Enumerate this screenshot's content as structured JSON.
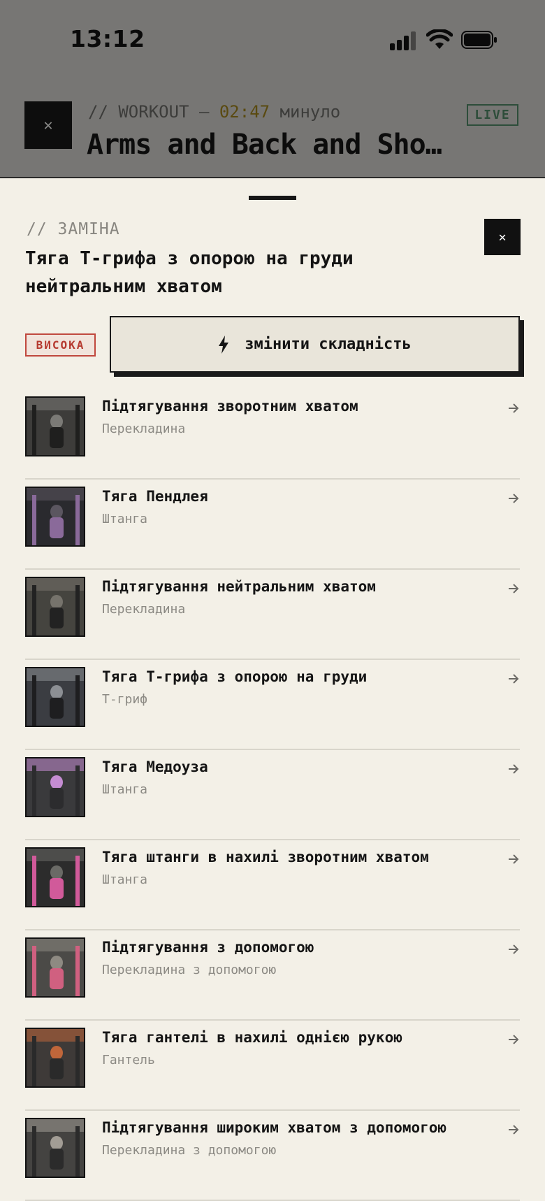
{
  "status_bar": {
    "time": "13:12"
  },
  "background": {
    "eyebrow_prefix": "// WORKOUT —",
    "timer": "02:47",
    "timer_suffix": "минуло",
    "title": "Arms and Back and Sho…",
    "live_label": "LIVE"
  },
  "sheet": {
    "eyebrow": "// ЗАМІНА",
    "exercise_title": "Тяга Т-грифа з опорою на груди нейтральним хватом",
    "difficulty_badge": "ВИСОКА",
    "change_difficulty_label": "змінити складність"
  },
  "alternatives": [
    {
      "name": "Підтягування зворотним хватом",
      "equipment": "Перекладина"
    },
    {
      "name": "Тяга Пендлея",
      "equipment": "Штанга"
    },
    {
      "name": "Підтягування нейтральним хватом",
      "equipment": "Перекладина"
    },
    {
      "name": "Тяга Т-грифа з опорою на груди",
      "equipment": "Т-гриф"
    },
    {
      "name": "Тяга Медоуза",
      "equipment": "Штанга"
    },
    {
      "name": "Тяга штанги в нахилі зворотним хватом",
      "equipment": "Штанга"
    },
    {
      "name": "Підтягування з допомогою",
      "equipment": "Перекладина з допомогою"
    },
    {
      "name": "Тяга гантелі в нахилі однією рукою",
      "equipment": "Гантель"
    },
    {
      "name": "Підтягування широким хватом з допомогою",
      "equipment": "Перекладина з допомогою"
    }
  ],
  "colors": {
    "accent_live": "#2d4d3a",
    "badge_red": "#b63a30",
    "background": "#f3f0e7"
  }
}
